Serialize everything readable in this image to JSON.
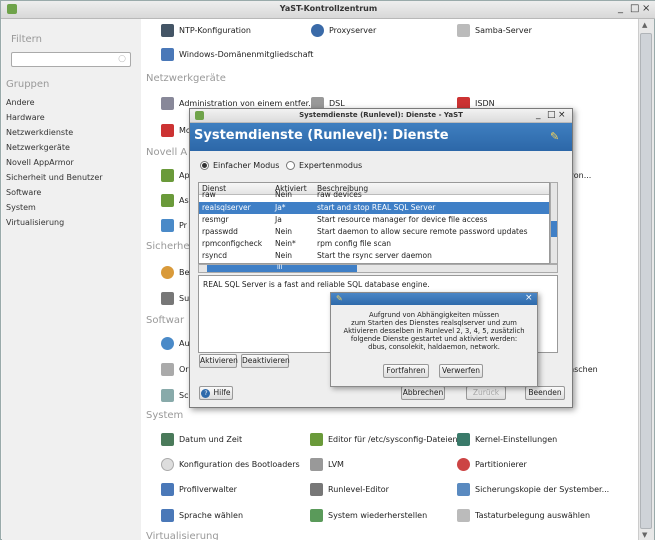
{
  "main_window": {
    "title": "YaST-Kontrollzentrum",
    "min_icon": "minimize-icon",
    "max_icon": "maximize-icon",
    "close_icon": "close-icon"
  },
  "sidebar": {
    "filter_heading": "Filtern",
    "groups_heading": "Gruppen",
    "items": [
      "Andere",
      "Hardware",
      "Netzwerkdienste",
      "Netzwerkgeräte",
      "Novell AppArmor",
      "Sicherheit und Benutzer",
      "Software",
      "System",
      "Virtualisierung"
    ]
  },
  "content": {
    "top_modules": [
      {
        "label": "NTP-Konfiguration",
        "icon": "ntp-icon"
      },
      {
        "label": "Proxyserver",
        "icon": "proxy-icon"
      },
      {
        "label": "Samba-Server",
        "icon": "samba-icon"
      },
      {
        "label": "Windows-Domänenmitgliedschaft",
        "icon": "windows-domain-icon"
      }
    ],
    "netz_heading": "Netzwerkgeräte",
    "netz_modules": [
      {
        "label": "Administration von einem entfer...",
        "icon": "remote-admin-icon"
      },
      {
        "label": "DSL",
        "icon": "dsl-icon"
      },
      {
        "label": "ISDN",
        "icon": "isdn-icon"
      },
      {
        "label": "Mc",
        "icon": "modem-icon"
      }
    ],
    "novell_heading": "Novell A",
    "novell_modules": [
      {
        "label": "Ap"
      },
      {
        "label": "As"
      },
      {
        "label": "Pr"
      }
    ],
    "novell_right": "von...",
    "sicher_heading": "Sicherhe",
    "sicher_modules": [
      {
        "label": "Be"
      },
      {
        "label": "Su"
      }
    ],
    "soft_heading": "Softwar",
    "soft_modules": [
      {
        "label": "Au"
      },
      {
        "label": "Or"
      },
      {
        "label": "Sc"
      }
    ],
    "soft_right": "nschen",
    "system_heading": "System",
    "system_modules": [
      {
        "label": "Datum und Zeit",
        "icon": "date-time-icon"
      },
      {
        "label": "Editor für /etc/sysconfig-Dateien",
        "icon": "sysconfig-editor-icon"
      },
      {
        "label": "Kernel-Einstellungen",
        "icon": "kernel-icon"
      },
      {
        "label": "Konfiguration des Bootloaders",
        "icon": "bootloader-icon"
      },
      {
        "label": "LVM",
        "icon": "lvm-icon"
      },
      {
        "label": "Partitionierer",
        "icon": "partitioner-icon"
      },
      {
        "label": "Profilverwalter",
        "icon": "profile-manager-icon"
      },
      {
        "label": "Runlevel-Editor",
        "icon": "runlevel-editor-icon"
      },
      {
        "label": "Sicherungskopie der Systember...",
        "icon": "backup-icon"
      },
      {
        "label": "Sprache wählen",
        "icon": "language-icon"
      },
      {
        "label": "System wiederherstellen",
        "icon": "restore-icon"
      },
      {
        "label": "Tastaturbelegung auswählen",
        "icon": "keyboard-icon"
      }
    ],
    "virt_heading": "Virtualisierung"
  },
  "dialog": {
    "title": "Systemdienste (Runlevel): Dienste - YaST",
    "heading": "Systemdienste (Runlevel): Dienste",
    "mode_simple": "Einfacher Modus",
    "mode_expert": "Expertenmodus",
    "columns": [
      "Dienst",
      "Aktiviert",
      "Beschreibung"
    ],
    "rows": [
      {
        "service": "raw",
        "enabled": "Nein",
        "desc": "raw devices"
      },
      {
        "service": "realsqlserver",
        "enabled": "Ja*",
        "desc": "start and stop REAL SQL Server",
        "selected": true
      },
      {
        "service": "resmgr",
        "enabled": "Ja",
        "desc": "Start resource manager for device file access"
      },
      {
        "service": "rpasswdd",
        "enabled": "Nein",
        "desc": "Start daemon to allow secure remote password updates"
      },
      {
        "service": "rpmconfigcheck",
        "enabled": "Nein*",
        "desc": "rpm config file scan"
      },
      {
        "service": "rsyncd",
        "enabled": "Nein",
        "desc": "Start the rsync server daemon"
      }
    ],
    "hscroll_mid": "III",
    "description": "REAL SQL Server is a fast and reliable SQL database engine.",
    "btn_enable": "Aktivieren",
    "btn_disable": "Deaktivieren",
    "btn_help": "Hilfe",
    "btn_cancel": "Abbrechen",
    "btn_back": "Zurück",
    "btn_finish": "Beenden"
  },
  "popup": {
    "message": "Aufgrund von Abhängigkeiten müssen\nzum Starten des Dienstes realsqlserver und zum\nAktivieren desselben in Runlevel 2, 3, 4, 5, zusätzlich\nfolgende Dienste gestartet und aktiviert werden:\ndbus, consolekit, haldaemon, network.",
    "btn_continue": "Fortfahren",
    "btn_discard": "Verwerfen"
  }
}
